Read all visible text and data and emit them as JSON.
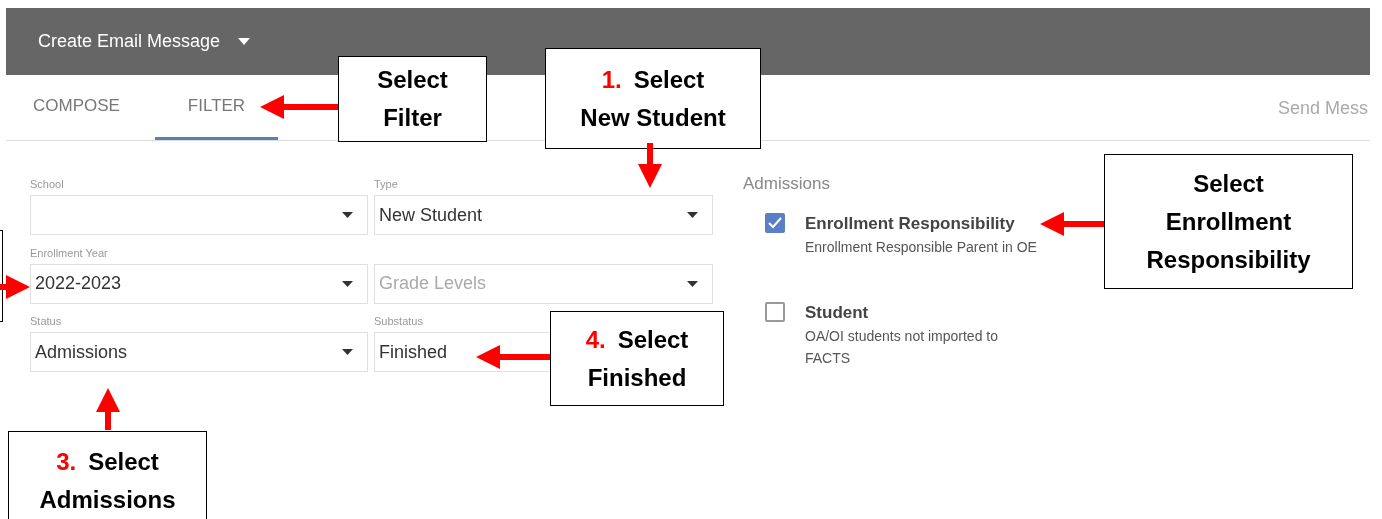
{
  "header": {
    "title": "Create Email Message"
  },
  "tabs": [
    {
      "label": "COMPOSE",
      "selected": false
    },
    {
      "label": "FILTER",
      "selected": true
    }
  ],
  "send_label": "Send Mess",
  "filters": [
    {
      "label": "School"
    },
    {
      "label": "Type",
      "value": "New Student"
    },
    {
      "label": "Enrollment Year",
      "value": "2022-2023"
    },
    {
      "placeholder": "Grade Levels"
    },
    {
      "label": "Status",
      "value": "Admissions"
    },
    {
      "label": "Substatus",
      "value": "Finished"
    }
  ],
  "admissions": {
    "heading": "Admissions",
    "options": [
      {
        "title": "Enrollment Responsibility",
        "description": "Enrollment Responsible Parent in OE",
        "checked": true
      },
      {
        "title": "Student",
        "description": "OA/OI students not imported to FACTS",
        "checked": false
      }
    ]
  },
  "callouts": [
    {
      "lines": [
        "Select",
        "Filter"
      ]
    },
    {
      "number": "1.",
      "lines": [
        "Select",
        "New Student"
      ]
    },
    {
      "lines": [
        "Select",
        "Enrollment",
        "Responsibility"
      ]
    },
    {
      "number": "4.",
      "lines": [
        "Select",
        "Finished"
      ]
    },
    {
      "number": "3.",
      "lines": [
        "Select",
        "Admissions"
      ]
    }
  ]
}
